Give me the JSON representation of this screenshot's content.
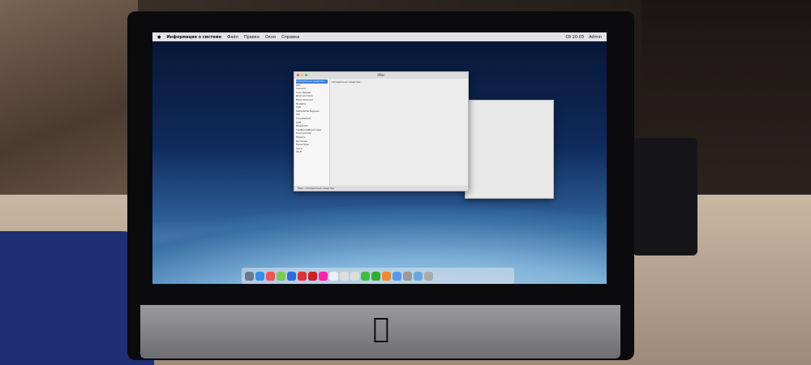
{
  "menubar": {
    "apple": "",
    "app": "Информация о системе",
    "items": [
      "Файл",
      "Правка",
      "Окно",
      "Справка"
    ],
    "clock": "Сб 20:03",
    "user": "Admin"
  },
  "window": {
    "title": "iMac",
    "sidebar": [
      "Аппаратные средства",
      "ATA",
      "Camera",
      "Card Reader",
      "Диагностика",
      "Fibre Channel",
      "FireWire",
      "SAS",
      "SATA/SATA Express",
      "SPI",
      "Thunderbolt",
      "USB",
      "Bluetooth",
      "Графика/Мониторы",
      "Контроллер",
      "Память",
      "Питание",
      "Принтеры",
      "Сеть",
      "Wi-Fi"
    ],
    "section": "Аппаратные средства:",
    "status": "iMac › Аппаратные средства"
  },
  "dock_colors": [
    "#6b7a8f",
    "#3a8ee6",
    "#e55",
    "#7c5",
    "#2b6cd8",
    "#d33",
    "#c22",
    "#f2a",
    "#eee",
    "#ddd",
    "#ddd",
    "#4b4",
    "#3a3",
    "#e83",
    "#59e",
    "#999",
    "#6ad",
    "#aaa"
  ]
}
